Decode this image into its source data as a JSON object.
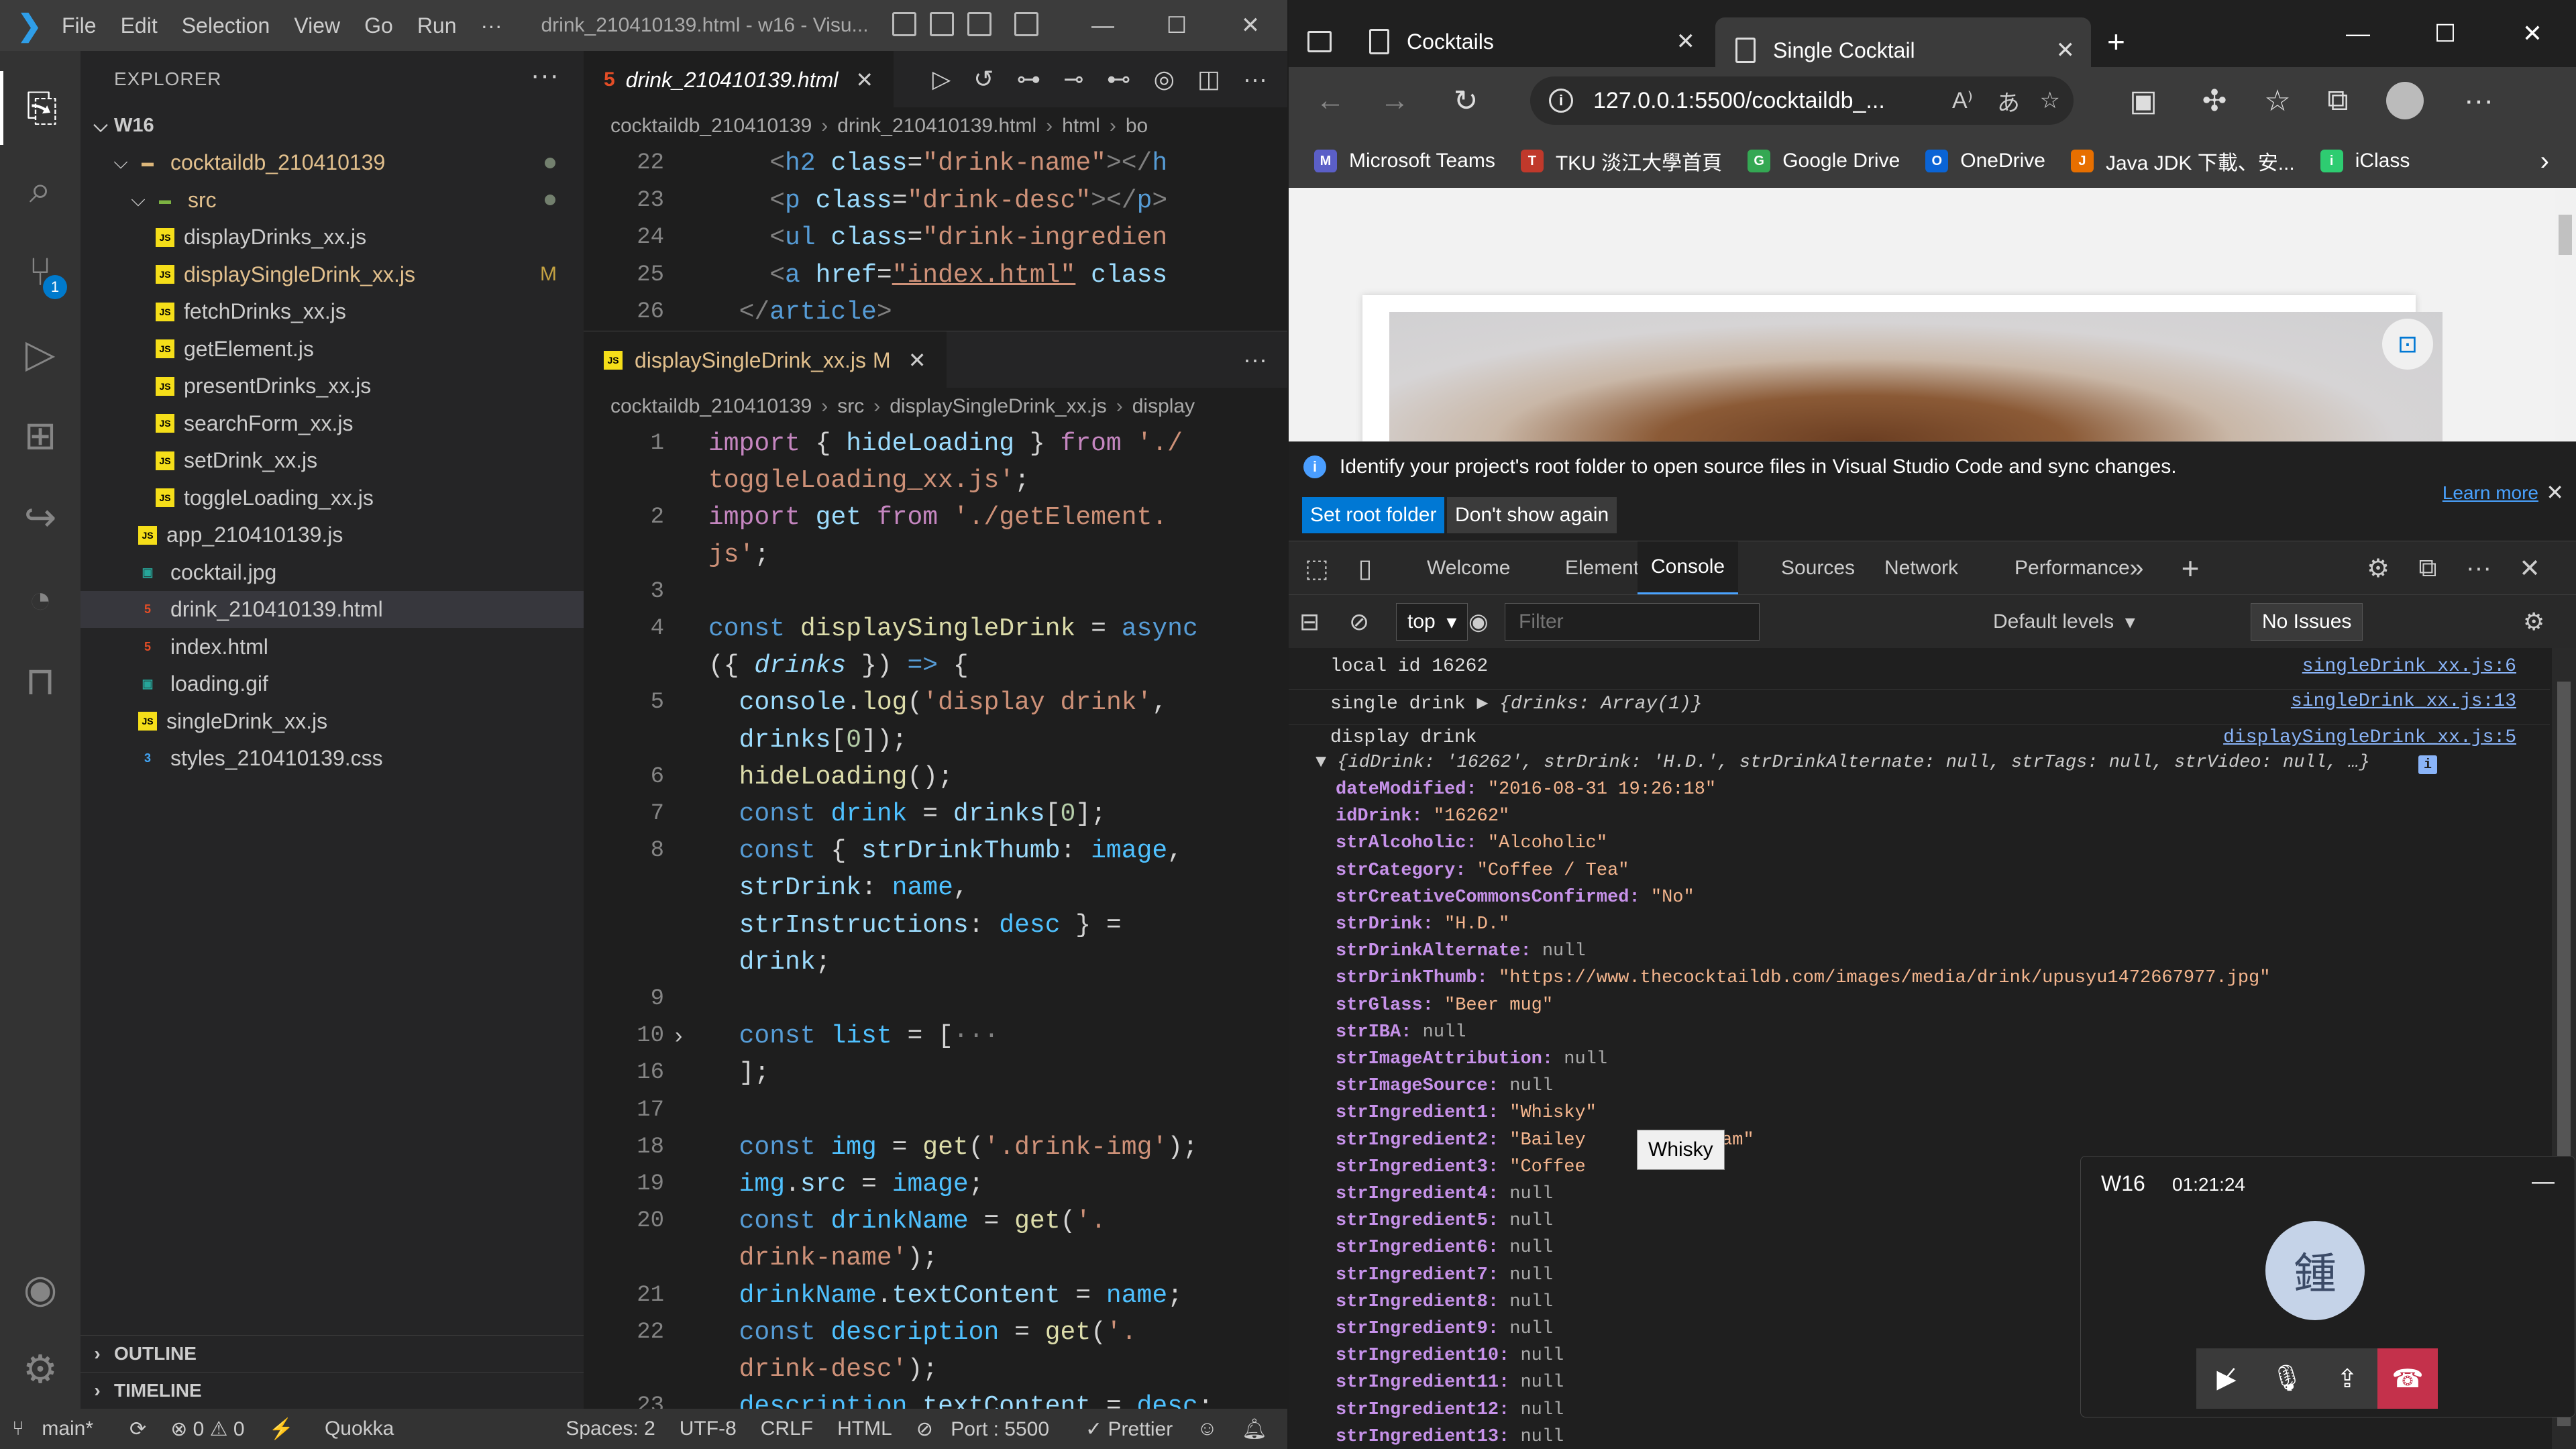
{
  "vscode": {
    "menu": [
      "File",
      "Edit",
      "Selection",
      "View",
      "Go",
      "Run",
      "···"
    ],
    "window_title": "drink_210410139.html - w16 - Visu...",
    "explorer_title": "EXPLORER",
    "workspace": "W16",
    "tree": [
      {
        "label": "cocktaildb_210410139",
        "type": "folder",
        "indent": 1,
        "open": true,
        "status": "dot"
      },
      {
        "label": "src",
        "type": "src-folder",
        "indent": 2,
        "open": true,
        "status": "dot"
      },
      {
        "label": "displayDrinks_xx.js",
        "type": "js",
        "indent": 3
      },
      {
        "label": "displaySingleDrink_xx.js",
        "type": "js",
        "indent": 3,
        "status": "M"
      },
      {
        "label": "fetchDrinks_xx.js",
        "type": "js",
        "indent": 3
      },
      {
        "label": "getElement.js",
        "type": "js",
        "indent": 3
      },
      {
        "label": "presentDrinks_xx.js",
        "type": "js",
        "indent": 3
      },
      {
        "label": "searchForm_xx.js",
        "type": "js",
        "indent": 3
      },
      {
        "label": "setDrink_xx.js",
        "type": "js",
        "indent": 3
      },
      {
        "label": "toggleLoading_xx.js",
        "type": "js",
        "indent": 3
      },
      {
        "label": "app_210410139.js",
        "type": "js",
        "indent": 2
      },
      {
        "label": "cocktail.jpg",
        "type": "img",
        "indent": 2
      },
      {
        "label": "drink_210410139.html",
        "type": "html",
        "indent": 2,
        "selected": true
      },
      {
        "label": "index.html",
        "type": "html",
        "indent": 2
      },
      {
        "label": "loading.gif",
        "type": "img",
        "indent": 2
      },
      {
        "label": "singleDrink_xx.js",
        "type": "js",
        "indent": 2
      },
      {
        "label": "styles_210410139.css",
        "type": "css",
        "indent": 2
      }
    ],
    "outline_label": "OUTLINE",
    "timeline_label": "TIMELINE",
    "editor1": {
      "tab_label": "drink_210410139.html",
      "breadcrumb": [
        "cocktaildb_210410139",
        "drink_210410139.html",
        "html",
        "bo"
      ],
      "lines": [
        {
          "n": "22",
          "html": "    <span class='brk'>&lt;</span><span class='tag'>h2</span> <span class='attr'>class</span>=<span class='str'>\"drink-name\"</span><span class='brk'>&gt;&lt;/</span><span class='tag'>h</span>"
        },
        {
          "n": "23",
          "html": "    <span class='brk'>&lt;</span><span class='tag'>p</span> <span class='attr'>class</span>=<span class='str'>\"drink-desc\"</span><span class='brk'>&gt;&lt;/</span><span class='tag'>p</span><span class='brk'>&gt;</span>"
        },
        {
          "n": "24",
          "html": "    <span class='brk'>&lt;</span><span class='tag'>ul</span> <span class='attr'>class</span>=<span class='str'>\"drink-ingredien</span>"
        },
        {
          "n": "25",
          "html": "    <span class='brk'>&lt;</span><span class='tag'>a</span> <span class='attr'>href</span>=<span class='str' style='text-decoration:underline'>\"index.html\"</span> <span class='attr'>class</span>"
        },
        {
          "n": "26",
          "html": "  <span class='brk'>&lt;/</span><span class='tag'>article</span><span class='brk'>&gt;</span>"
        }
      ]
    },
    "editor2": {
      "tab_label": "displaySingleDrink_xx.js",
      "tab_status": "M",
      "breadcrumb": [
        "cocktaildb_210410139",
        "src",
        "displaySingleDrink_xx.js",
        "display"
      ],
      "lines": [
        {
          "n": "1",
          "html": "<span class='kw2'>import</span> { <span class='var'>hideLoading</span> } <span class='kw2'>from</span> <span class='str'>'./</span>"
        },
        {
          "n": "",
          "html": "<span class='str'>toggleLoading_xx.js'</span>;"
        },
        {
          "n": "2",
          "html": "<span class='kw2'>import</span> <span class='var'>get</span> <span class='kw2'>from</span> <span class='str'>'./getElement.</span>"
        },
        {
          "n": "",
          "html": "<span class='str'>js'</span>;"
        },
        {
          "n": "3",
          "html": ""
        },
        {
          "n": "4",
          "html": "<span class='kw'>const</span> <span class='fn'>displaySingleDrink</span> = <span class='kw'>async</span>"
        },
        {
          "n": "",
          "html": "({ <span class='var ital'>drinks</span> }) <span class='kw'>=&gt;</span> {"
        },
        {
          "n": "5",
          "html": "  <span class='var'>console</span>.<span class='fn'>log</span>(<span class='str'>'display drink'</span>,"
        },
        {
          "n": "",
          "html": "  <span class='var'>drinks</span>[<span style='color:#b5cea8'>0</span>]);"
        },
        {
          "n": "6",
          "html": "  <span class='fn'>hideLoading</span>();"
        },
        {
          "n": "7",
          "html": "  <span class='kw'>const</span> <span class='cst'>drink</span> = <span class='var'>drinks</span>[<span style='color:#b5cea8'>0</span>];"
        },
        {
          "n": "8",
          "html": "  <span class='kw'>const</span> { <span class='var'>strDrinkThumb</span>: <span class='cst'>image</span>,"
        },
        {
          "n": "",
          "html": "  <span class='var'>strDrink</span>: <span class='cst'>name</span>,"
        },
        {
          "n": "",
          "html": "  <span class='var'>strInstructions</span>: <span class='cst'>desc</span> } ="
        },
        {
          "n": "",
          "html": "  <span class='var'>drink</span>;"
        },
        {
          "n": "9",
          "html": ""
        },
        {
          "n": "10",
          "html": "  <span class='kw'>const</span> <span class='cst'>list</span> = [<span class='brk'>···</span>"
        },
        {
          "n": "16",
          "html": "  ];"
        },
        {
          "n": "17",
          "html": ""
        },
        {
          "n": "18",
          "html": "  <span class='kw'>const</span> <span class='cst'>img</span> = <span class='fn'>get</span>(<span class='str'>'.drink-img'</span>);"
        },
        {
          "n": "19",
          "html": "  <span class='cst'>img</span>.<span class='var'>src</span> = <span class='cst'>image</span>;"
        },
        {
          "n": "20",
          "html": "  <span class='kw'>const</span> <span class='cst'>drinkName</span> = <span class='fn'>get</span>(<span class='str'>'.</span>"
        },
        {
          "n": "",
          "html": "  <span class='str'>drink-name'</span>);"
        },
        {
          "n": "21",
          "html": "  <span class='cst'>drinkName</span>.<span class='var'>textContent</span> = <span class='cst'>name</span>;"
        },
        {
          "n": "22",
          "html": "  <span class='kw'>const</span> <span class='cst'>description</span> = <span class='fn'>get</span>(<span class='str'>'.</span>"
        },
        {
          "n": "",
          "html": "  <span class='str'>drink-desc'</span>);"
        },
        {
          "n": "23",
          "html": "  <span class='cst'>description</span>.<span class='var'>textContent</span> = <span class='cst'>desc</span>;"
        }
      ]
    },
    "statusbar": {
      "branch": "main*",
      "errors": "⊗ 0 ⚠ 0",
      "quokka": "Quokka",
      "spaces": "Spaces: 2",
      "encoding": "UTF-8",
      "eol": "CRLF",
      "language": "HTML",
      "port": "Port : 5500",
      "prettier": "✓ Prettier"
    }
  },
  "edge": {
    "tabs": [
      {
        "label": "Cocktails"
      },
      {
        "label": "Single Cocktail",
        "active": true
      }
    ],
    "url": "127.0.0.1:5500/cocktaildb_...",
    "favorites": [
      {
        "label": "Microsoft Teams",
        "color": "#5b5fc7"
      },
      {
        "label": "TKU 淡江大學首頁",
        "color": "#c0392b"
      },
      {
        "label": "Google Drive",
        "color": "#34a853"
      },
      {
        "label": "OneDrive",
        "color": "#0a64d6"
      },
      {
        "label": "Java JDK 下載、安...",
        "color": "#e76f00"
      },
      {
        "label": "iClass",
        "color": "#2ecc71"
      }
    ],
    "infobar": {
      "message": "Identify your project's root folder to open source files in Visual Studio Code and sync changes.",
      "primary": "Set root folder",
      "secondary": "Don't show again",
      "learn_more": "Learn more"
    },
    "devtools": {
      "tabs": [
        "Welcome",
        "Elements",
        "Console",
        "Sources",
        "Network",
        "Performance"
      ],
      "active_tab": "Console",
      "context": "top",
      "filter_placeholder": "Filter",
      "levels": "Default levels",
      "issues": "No Issues",
      "console": [
        {
          "text": "local id 16262",
          "src": "singleDrink_xx.js:6"
        },
        {
          "text": "single drink ",
          "obj": "▶ {drinks: Array(1)}",
          "src": "singleDrink_xx.js:13"
        },
        {
          "text": "display drink",
          "src": "displaySingleDrink_xx.js:5"
        }
      ],
      "object_preview": "▼ {idDrink: '16262', strDrink: 'H.D.', strDrinkAlternate: null, strTags: null, strVideo: null, …}",
      "props": [
        {
          "k": "dateModified",
          "v": "\"2016-08-31 19:26:18\"",
          "t": "s"
        },
        {
          "k": "idDrink",
          "v": "\"16262\"",
          "t": "s"
        },
        {
          "k": "strAlcoholic",
          "v": "\"Alcoholic\"",
          "t": "s"
        },
        {
          "k": "strCategory",
          "v": "\"Coffee / Tea\"",
          "t": "s"
        },
        {
          "k": "strCreativeCommonsConfirmed",
          "v": "\"No\"",
          "t": "s"
        },
        {
          "k": "strDrink",
          "v": "\"H.D.\"",
          "t": "s"
        },
        {
          "k": "strDrinkAlternate",
          "v": "null",
          "t": "n"
        },
        {
          "k": "strDrinkThumb",
          "v": "\"https://www.thecocktaildb.com/images/media/drink/upusyu1472667977.jpg\"",
          "t": "s"
        },
        {
          "k": "strGlass",
          "v": "\"Beer mug\"",
          "t": "s"
        },
        {
          "k": "strIBA",
          "v": "null",
          "t": "n"
        },
        {
          "k": "strImageAttribution",
          "v": "null",
          "t": "n"
        },
        {
          "k": "strImageSource",
          "v": "null",
          "t": "n"
        },
        {
          "k": "strIngredient1",
          "v": "\"Whisky\"",
          "t": "s"
        },
        {
          "k": "strIngredient2",
          "v": "\"Bailey",
          "tail": "ream\"",
          "t": "s"
        },
        {
          "k": "strIngredient3",
          "v": "\"Coffee",
          "t": "s"
        },
        {
          "k": "strIngredient4",
          "v": "null",
          "t": "n"
        },
        {
          "k": "strIngredient5",
          "v": "null",
          "t": "n"
        },
        {
          "k": "strIngredient6",
          "v": "null",
          "t": "n"
        },
        {
          "k": "strIngredient7",
          "v": "null",
          "t": "n"
        },
        {
          "k": "strIngredient8",
          "v": "null",
          "t": "n"
        },
        {
          "k": "strIngredient9",
          "v": "null",
          "t": "n"
        },
        {
          "k": "strIngredient10",
          "v": "null",
          "t": "n"
        },
        {
          "k": "strIngredient11",
          "v": "null",
          "t": "n"
        },
        {
          "k": "strIngredient12",
          "v": "null",
          "t": "n"
        },
        {
          "k": "strIngredient13",
          "v": "null",
          "t": "n"
        }
      ],
      "tooltip": "Whisky"
    }
  },
  "teams": {
    "title": "W16",
    "time": "01:21:24",
    "avatar_initial": "鍾"
  }
}
